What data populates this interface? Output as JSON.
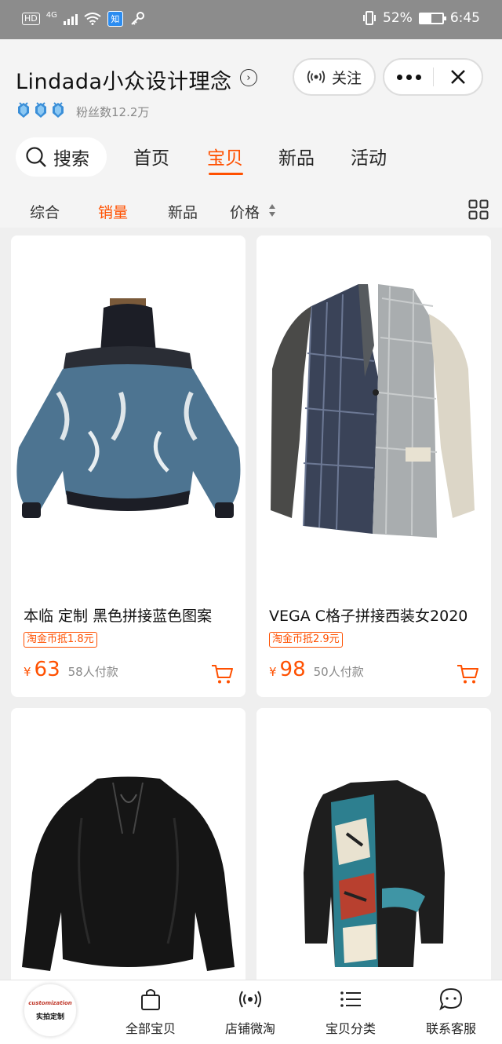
{
  "status_bar": {
    "hd": "HD",
    "network": "4G",
    "app_badge": "知",
    "battery_percent": "52%",
    "battery_level": 0.52,
    "time": "6:45"
  },
  "header": {
    "shop_name": "Lindada小众设计理念",
    "follow_label": "关注",
    "fans": "粉丝数12.2万",
    "crown_badges": [
      "crown-badge-icon",
      "crown-badge-icon",
      "crown-badge-icon"
    ]
  },
  "nav": {
    "search_label": "搜索",
    "tabs": [
      {
        "label": "首页",
        "active": false
      },
      {
        "label": "宝贝",
        "active": true
      },
      {
        "label": "新品",
        "active": false
      },
      {
        "label": "活动",
        "active": false
      }
    ]
  },
  "sort": {
    "items": [
      {
        "label": "综合",
        "active": false
      },
      {
        "label": "销量",
        "active": true
      },
      {
        "label": "新品",
        "active": false
      },
      {
        "label": "价格",
        "active": false
      }
    ]
  },
  "products": [
    {
      "title": "本临 定制 黑色拼接蓝色图案",
      "coupon": "淘金币抵1.8元",
      "currency": "¥",
      "price": "63",
      "sold": "58人付款"
    },
    {
      "title": "VEGA C格子拼接西装女2020",
      "coupon": "淘金币抵2.9元",
      "currency": "¥",
      "price": "98",
      "sold": "50人付款"
    },
    {
      "title": "",
      "coupon": "",
      "currency": "",
      "price": "",
      "sold": ""
    },
    {
      "title": "",
      "coupon": "",
      "currency": "",
      "price": "",
      "sold": ""
    }
  ],
  "bottom_bar": {
    "logo_top": "customization",
    "logo_bottom": "实拍定制",
    "items": [
      {
        "label": "全部宝贝",
        "icon": "bag-icon"
      },
      {
        "label": "店铺微淘",
        "icon": "broadcast-icon"
      },
      {
        "label": "宝贝分类",
        "icon": "list-icon"
      },
      {
        "label": "联系客服",
        "icon": "chat-icon"
      }
    ]
  },
  "colors": {
    "accent": "#ff5000",
    "statusbar": "#8c8c8c",
    "background": "#efefef"
  }
}
